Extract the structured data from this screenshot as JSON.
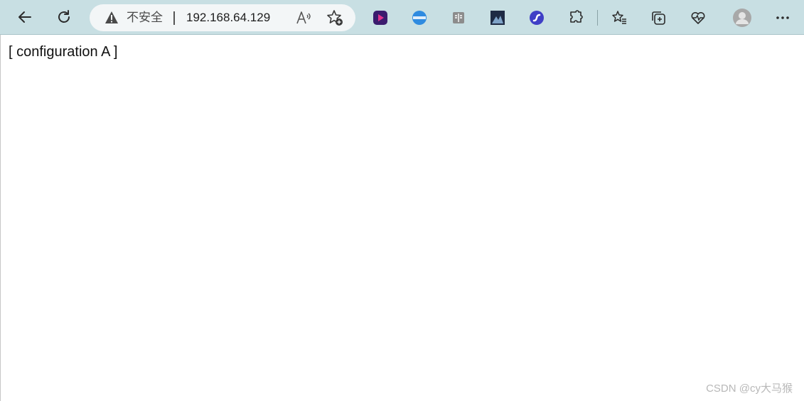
{
  "toolbar": {
    "back_icon": "back-arrow-icon",
    "refresh_icon": "refresh-icon",
    "address_bar": {
      "security_label": "不安全",
      "url": "192.168.64.129",
      "read_aloud_icon": "read-aloud-icon",
      "favorite_icon": "add-favorite-icon"
    },
    "extensions": [
      "video-ext-icon",
      "magic-ext-icon",
      "reader-ext-icon",
      "photo-ext-icon",
      "swirl-ext-icon"
    ],
    "right_icons": [
      "extensions-icon",
      "favorites-icon",
      "collections-icon",
      "performance-icon",
      "profile-avatar-icon",
      "more-menu-icon"
    ]
  },
  "page": {
    "content_text": "[ configuration A ]"
  },
  "watermark": "CSDN @cy大马猴",
  "colors": {
    "toolbar_bg": "#c8dfe3",
    "address_bg": "#f3f6f7",
    "page_bg": "#ffffff"
  }
}
